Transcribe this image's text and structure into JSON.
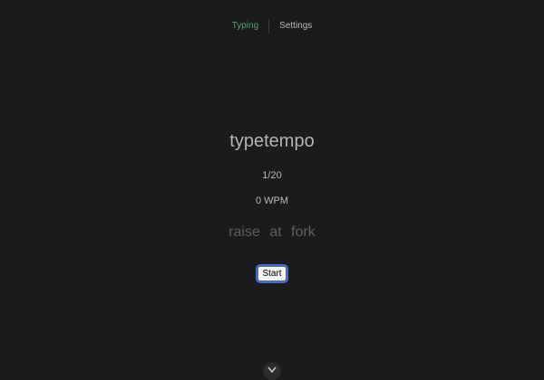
{
  "nav": {
    "tabs": [
      {
        "label": "Typing",
        "active": true
      },
      {
        "label": "Settings",
        "active": false
      }
    ],
    "active_color": "#4fa567"
  },
  "main": {
    "title": "typetempo",
    "progress": "1/20",
    "wpm": "0 WPM",
    "words": "raise at fork",
    "start_label": "Start"
  },
  "scroll": {
    "icon": "chevron-down-icon"
  }
}
